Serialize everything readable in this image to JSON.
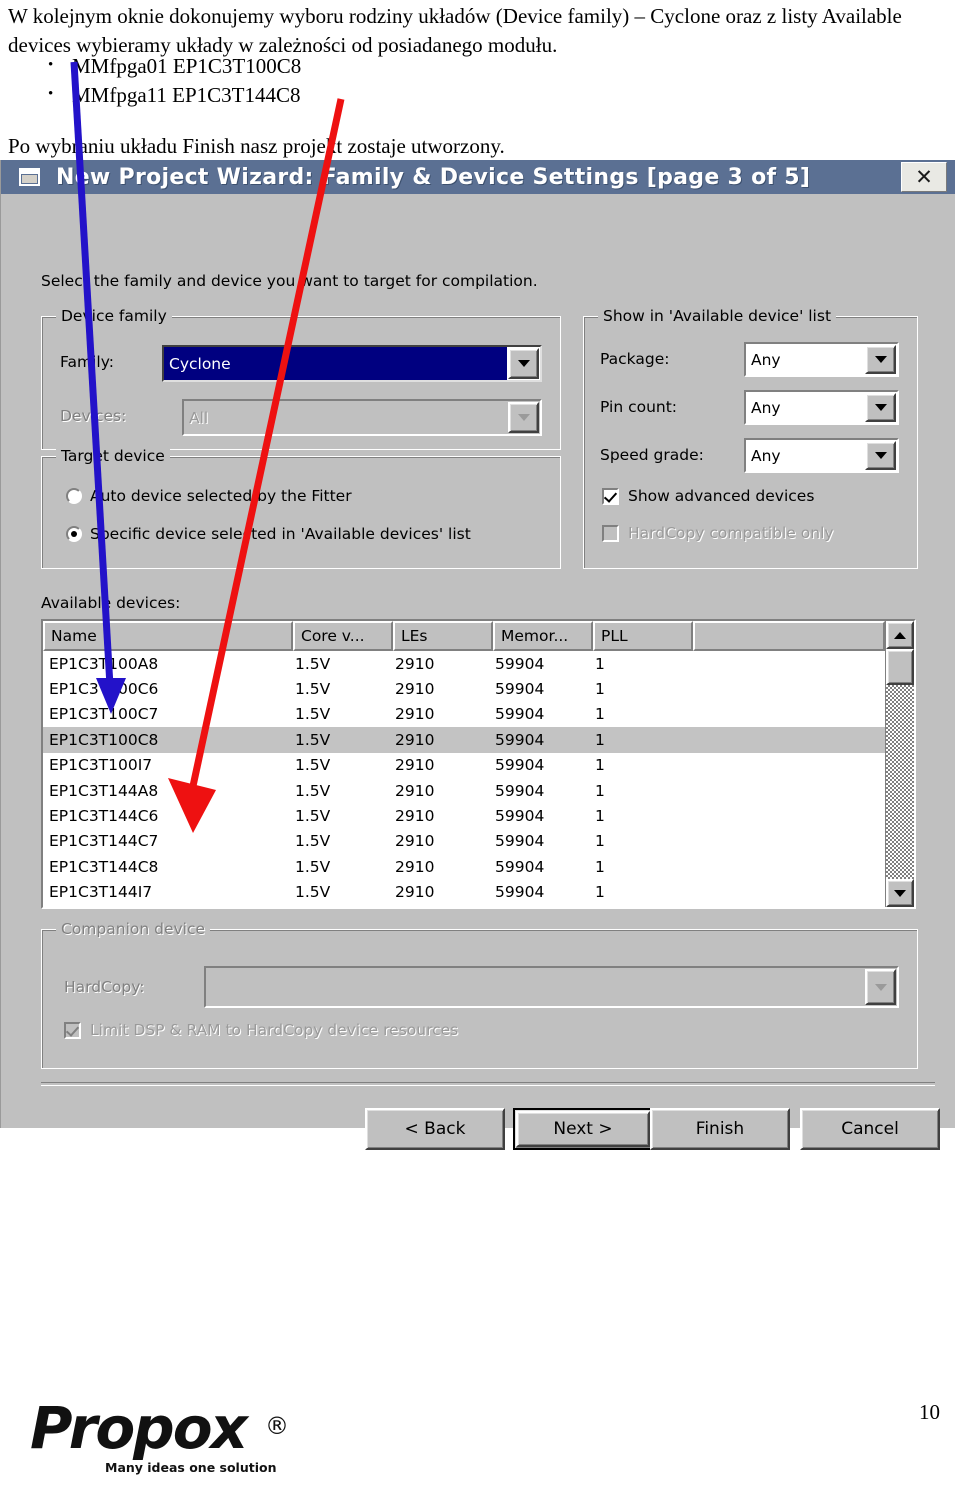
{
  "document": {
    "paragraph1": "W kolejnym oknie dokonujemy wyboru rodziny układów (Device family) – Cyclone oraz z listy Available devices wybieramy układy w zależności od posiadanego modułu.",
    "bullets": [
      "MMfpga01 EP1C3T100C8",
      "MMfpga11 EP1C3T144C8"
    ],
    "paragraph2": "Po wybraniu układu Finish nasz projekt zostaje utworzony.",
    "page_number": "10",
    "logo_word": "Propox",
    "logo_registered": "®",
    "logo_tagline": "Many ideas one solution"
  },
  "dialog": {
    "title": "New Project Wizard: Family & Device Settings [page 3 of 5]",
    "close_label": "✕",
    "intro": "Select the family and device you want to target for compilation.",
    "device_family": {
      "group_label": "Device family",
      "family_label": "Family:",
      "family_value": "Cyclone",
      "devices_label": "Devices:",
      "devices_value": "All"
    },
    "show_list": {
      "group_label": "Show in 'Available device' list",
      "package_label": "Package:",
      "package_value": "Any",
      "pin_count_label": "Pin count:",
      "pin_count_value": "Any",
      "speed_grade_label": "Speed grade:",
      "speed_grade_value": "Any",
      "show_advanced_label": "Show advanced devices",
      "show_advanced_checked": true,
      "hardcopy_only_label": "HardCopy compatible only",
      "hardcopy_only_checked": false
    },
    "target_device": {
      "group_label": "Target device",
      "auto_label": "Auto device selected by the Fitter",
      "specific_label": "Specific device selected in 'Available devices' list",
      "selected": "specific"
    },
    "available_devices": {
      "label": "Available devices:",
      "columns": [
        "Name",
        "Core v...",
        "LEs",
        "Memor...",
        "PLL",
        ""
      ],
      "selected_row": 3,
      "rows": [
        [
          "EP1C3T100A8",
          "1.5V",
          "2910",
          "59904",
          "1"
        ],
        [
          "EP1C3T100C6",
          "1.5V",
          "2910",
          "59904",
          "1"
        ],
        [
          "EP1C3T100C7",
          "1.5V",
          "2910",
          "59904",
          "1"
        ],
        [
          "EP1C3T100C8",
          "1.5V",
          "2910",
          "59904",
          "1"
        ],
        [
          "EP1C3T100I7",
          "1.5V",
          "2910",
          "59904",
          "1"
        ],
        [
          "EP1C3T144A8",
          "1.5V",
          "2910",
          "59904",
          "1"
        ],
        [
          "EP1C3T144C6",
          "1.5V",
          "2910",
          "59904",
          "1"
        ],
        [
          "EP1C3T144C7",
          "1.5V",
          "2910",
          "59904",
          "1"
        ],
        [
          "EP1C3T144C8",
          "1.5V",
          "2910",
          "59904",
          "1"
        ],
        [
          "EP1C3T144I7",
          "1.5V",
          "2910",
          "59904",
          "1"
        ]
      ]
    },
    "companion_device": {
      "group_label": "Companion device",
      "hardcopy_label": "HardCopy:",
      "hardcopy_value": "",
      "limit_label": "Limit DSP & RAM to HardCopy device resources",
      "limit_checked": true
    },
    "buttons": {
      "back": "< Back",
      "next": "Next >",
      "finish": "Finish",
      "cancel": "Cancel"
    }
  },
  "annotations": {
    "blue_arrow_color": "#2312c9",
    "red_arrow_color": "#ee1111"
  },
  "colors": {
    "titlebar": "#5b7093",
    "dialog_face": "#c0c0c0",
    "selection_blue": "#000080",
    "row_highlight": "#c3c3c3"
  }
}
